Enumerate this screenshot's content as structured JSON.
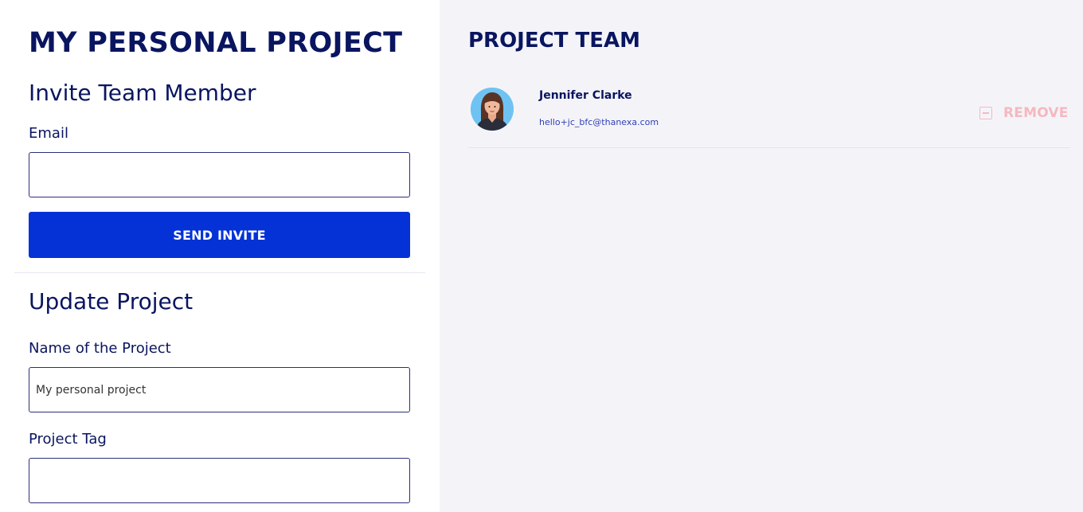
{
  "page": {
    "title": "MY PERSONAL PROJECT"
  },
  "invite": {
    "title": "Invite Team Member",
    "email_label": "Email",
    "email_value": "",
    "send_label": "SEND INVITE"
  },
  "update": {
    "title": "Update Project",
    "name_label": "Name of the Project",
    "name_value": "My personal project",
    "tag_label": "Project Tag",
    "tag_value": ""
  },
  "team": {
    "title": "PROJECT TEAM",
    "members": [
      {
        "name": "Jennifer Clarke",
        "email": "hello+jc_bfc@thanexa.com",
        "avatar_icon": "woman-avatar",
        "remove_label": "REMOVE",
        "remove_icon": "minus-square-icon"
      }
    ]
  },
  "colors": {
    "primary": "#0432d6",
    "heading": "#0a1560",
    "remove": "#f5b8c0",
    "panel_bg": "#f4f4f8"
  }
}
